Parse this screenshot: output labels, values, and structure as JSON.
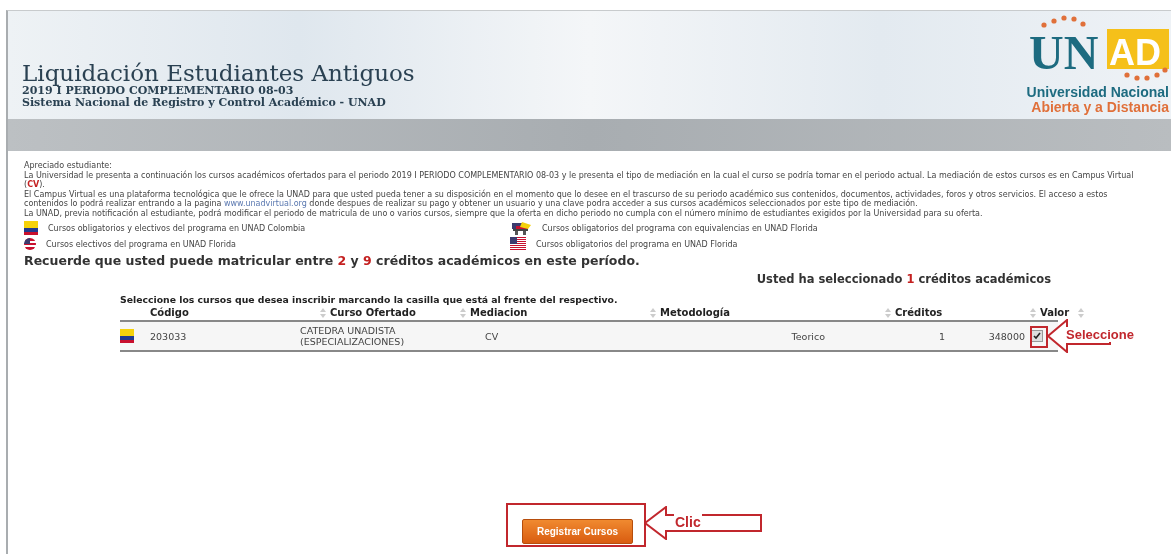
{
  "header": {
    "title": "Liquidación Estudiantes Antiguos",
    "period": "2019 I PERIODO COMPLEMENTARIO 08-03",
    "system": "Sistema Nacional de Registro y Control Académico - UNAD"
  },
  "logo": {
    "letters": "UN",
    "highlight": "AD",
    "line1": "Universidad Nacional",
    "line2": "Abierta y a Distancia"
  },
  "notice": {
    "greeting": "Apreciado estudiante:",
    "line1": "La Universidad le presenta a continuación los cursos académicos ofertados para el periodo 2019 I PERIODO COMPLEMENTARIO 08-03 y le presenta el tipo de mediación en la cual el curso se podría tomar en el periodo actual. La mediación de estos cursos es en Campus Virtual (**CV**).",
    "line2_before": "El Campus Virtual es una plataforma tecnológica que le ofrece la UNAD para que usted pueda tener a su disposición en el momento que lo desee en el trascurso de su periodo académico sus contenidos, documentos, actividades, foros y otros servicios. El acceso a estos contenidos lo podrá realizar entrando a la pagina",
    "link": "www.unadvirtual.org",
    "line2_after": "donde despues de realizar su pago y obtener un usuario y una clave podra acceder a sus cursos académicos seleccionados por este tipo de mediación.",
    "line3": "La UNAD, previa notificación al estudiante, podrá modificar el periodo de matricula de uno o varios cursos, siempre que la oferta en dicho periodo no cumpla con el número mínimo de estudiantes exigidos por la Universidad para su oferta."
  },
  "legend": [
    {
      "kind": "colombia",
      "label": "Cursos obligatorios y electivos del programa en UNAD Colombia"
    },
    {
      "kind": "mixed",
      "label": "Cursos obligatorios del programa con equivalencias en UNAD Florida"
    },
    {
      "kind": "usa_round",
      "label": "Cursos electivos del programa en UNAD Florida"
    },
    {
      "kind": "usa",
      "label": "Cursos obligatorios del programa en UNAD Florida"
    }
  ],
  "credits_note": "Recuerde que usted puede matricular entre **2** y **9** créditos académicos en este período.",
  "selected_note": "Usted ha seleccionado **1** créditos académicos",
  "instruction": "Seleccione los cursos que desea inscribir marcando la casilla que está al frente del respectivo.",
  "table": {
    "columns": [
      "Código",
      "Curso Ofertado",
      "Mediacion",
      "Metodología",
      "Créditos",
      "Valor"
    ],
    "rows": [
      {
        "kind": "colombia",
        "code": "203033",
        "course": "CATEDRA UNADISTA (ESPECIALIZACIONES)",
        "mediation": "CV",
        "methodology": "Teorico",
        "credits": "1",
        "value": "348000",
        "checked": true
      }
    ]
  },
  "annotations": {
    "checkbox_label": "Seleccione",
    "button_label": "Clic"
  },
  "submit_button": "Registrar Cursos"
}
